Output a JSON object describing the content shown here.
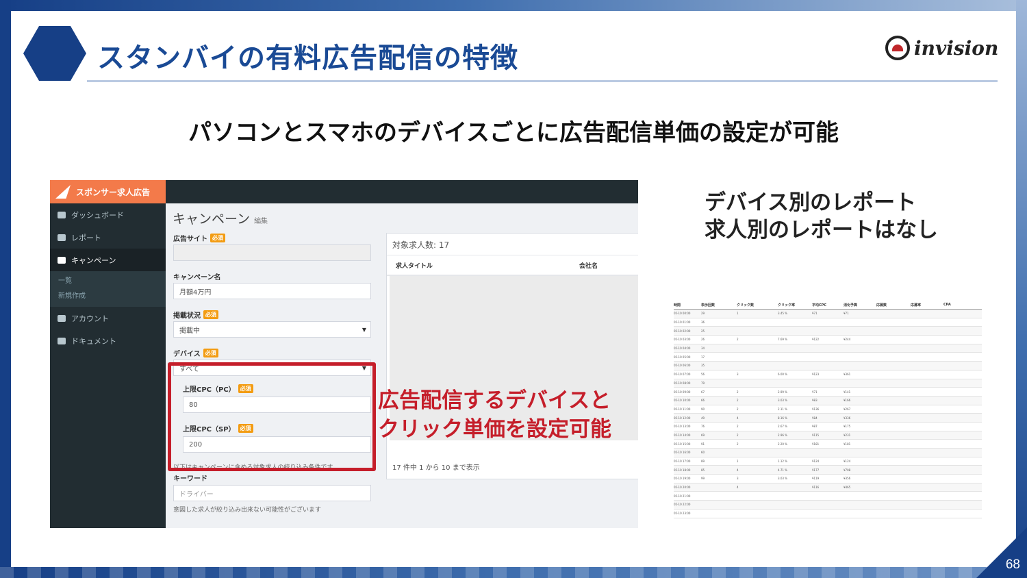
{
  "slide": {
    "title": "スタンバイの有料広告配信の特徴",
    "logo_text": "invision",
    "subtitle": "パソコンとスマホのデバイスごとに広告配信単価の設定が可能",
    "page_number": "68",
    "annotation_line1": "広告配信するデバイスと",
    "annotation_line2": "クリック単価を設定可能",
    "report_note_line1": "デバイス別のレポート",
    "report_note_line2": "求人別のレポートはなし"
  },
  "app": {
    "brand": "スポンサー求人広告",
    "sidebar": {
      "items": [
        {
          "label": "ダッシュボード",
          "icon": "dashboard-icon"
        },
        {
          "label": "レポート",
          "icon": "chart-icon"
        },
        {
          "label": "キャンペーン",
          "icon": "flag-icon"
        },
        {
          "label": "アカウント",
          "icon": "user-icon"
        },
        {
          "label": "ドキュメント",
          "icon": "document-icon"
        }
      ],
      "sub_items": [
        "一覧",
        "新規作成"
      ]
    },
    "page_title": "キャンペーン",
    "page_subtitle": "編集",
    "form": {
      "required_badge": "必須",
      "site_label": "広告サイト",
      "site_value": "",
      "name_label": "キャンペーン名",
      "name_value": "月額4万円",
      "status_label": "掲載状況",
      "status_value": "掲載中",
      "device_label": "デバイス",
      "device_value": "すべて",
      "cpc_pc_label": "上限CPC（PC）",
      "cpc_pc_value": "80",
      "cpc_sp_label": "上限CPC（SP）",
      "cpc_sp_value": "200",
      "filter_help": "以下はキャンペーンに含める対象求人の絞り込み条件です",
      "keyword_label": "キーワード",
      "keyword_placeholder": "ドライバー",
      "keyword_help": "意図した求人が絞り込み出来ない可能性がございます"
    },
    "jobs_card": {
      "title": "対象求人数: 17",
      "col_title": "求人タイトル",
      "col_company": "会社名",
      "footer": "17 件中 1 から 10 まで表示"
    }
  },
  "report_table": {
    "headers": [
      "時間",
      "表示回数",
      "クリック数",
      "クリック率",
      "平均CPC",
      "消化予算",
      "応募数",
      "応募率",
      "CPA"
    ],
    "rows": [
      [
        "05-10 00:00",
        "29",
        "1",
        "3.45 %",
        "¥71",
        "¥71",
        "",
        "",
        ""
      ],
      [
        "05-10 01:00",
        "36",
        "",
        "",
        "",
        "",
        "",
        "",
        ""
      ],
      [
        "05-10 02:00",
        "25",
        "",
        "",
        "",
        "",
        "",
        "",
        ""
      ],
      [
        "05-10 03:00",
        "26",
        "2",
        "7.69 %",
        "¥122",
        "¥244",
        "",
        "",
        ""
      ],
      [
        "05-10 04:00",
        "34",
        "",
        "",
        "",
        "",
        "",
        "",
        ""
      ],
      [
        "05-10 05:00",
        "17",
        "",
        "",
        "",
        "",
        "",
        "",
        ""
      ],
      [
        "05-10 06:00",
        "35",
        "",
        "",
        "",
        "",
        "",
        "",
        ""
      ],
      [
        "05-10 07:00",
        "56",
        "3",
        "6.00 %",
        "¥123",
        "¥361",
        "",
        "",
        ""
      ],
      [
        "05-10 08:00",
        "79",
        "",
        "",
        "",
        "",
        "",
        "",
        ""
      ],
      [
        "05-10 09:00",
        "67",
        "2",
        "2.99 %",
        "¥71",
        "¥141",
        "",
        "",
        ""
      ],
      [
        "05-10 10:00",
        "66",
        "2",
        "3.03 %",
        "¥83",
        "¥166",
        "",
        "",
        ""
      ],
      [
        "05-10 11:00",
        "90",
        "2",
        "2.11 %",
        "¥136",
        "¥267",
        "",
        "",
        ""
      ],
      [
        "05-10 12:00",
        "49",
        "4",
        "8.16 %",
        "¥84",
        "¥336",
        "",
        "",
        ""
      ],
      [
        "05-10 13:00",
        "76",
        "2",
        "2.67 %",
        "¥87",
        "¥175",
        "",
        "",
        ""
      ],
      [
        "05-10 14:00",
        "69",
        "2",
        "2.96 %",
        "¥115",
        "¥231",
        "",
        "",
        ""
      ],
      [
        "05-10 15:00",
        "91",
        "2",
        "2.20 %",
        "¥181",
        "¥181",
        "",
        "",
        ""
      ],
      [
        "05-10 16:00",
        "60",
        "",
        "",
        "",
        "",
        "",
        "",
        ""
      ],
      [
        "05-10 17:00",
        "89",
        "1",
        "1.12 %",
        "¥124",
        "¥124",
        "",
        "",
        ""
      ],
      [
        "05-10 18:00",
        "85",
        "4",
        "4.71 %",
        "¥177",
        "¥708",
        "",
        "",
        ""
      ],
      [
        "05-10 19:00",
        "99",
        "3",
        "3.03 %",
        "¥119",
        "¥356",
        "",
        "",
        ""
      ],
      [
        "05-10 20:00",
        "",
        "4",
        "",
        "¥116",
        "¥465",
        "",
        "",
        ""
      ],
      [
        "05-10 21:00",
        "",
        "",
        "",
        "",
        "",
        "",
        "",
        ""
      ],
      [
        "05-10 22:00",
        "",
        "",
        "",
        "",
        "",
        "",
        "",
        ""
      ],
      [
        "05-10 23:00",
        "",
        "",
        "",
        "",
        "",
        "",
        "",
        ""
      ]
    ]
  },
  "colors": {
    "brand_blue": "#163f86",
    "title_blue": "#1a4a95",
    "accent_red": "#c51e2a",
    "app_orange": "#f37a4a",
    "sidebar_dark": "#222d32"
  }
}
